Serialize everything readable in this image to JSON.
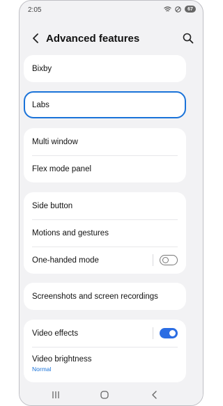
{
  "status_bar": {
    "time": "2:05",
    "battery": "67"
  },
  "header": {
    "title": "Advanced features",
    "back_icon": "chevron-left-icon",
    "search_icon": "search-icon"
  },
  "cards": {
    "bixby": {
      "label": "Bixby"
    },
    "labs": {
      "label": "Labs"
    },
    "multi": {
      "multi_window": "Multi window",
      "flex_mode_panel": "Flex mode panel"
    },
    "side": {
      "side_button": "Side button",
      "motions_gestures": "Motions and gestures",
      "one_handed_mode": "One-handed mode",
      "one_handed_enabled": false
    },
    "screenshots": {
      "label": "Screenshots and screen recordings"
    },
    "video": {
      "video_effects": "Video effects",
      "video_effects_enabled": true,
      "video_brightness": "Video brightness",
      "video_brightness_value": "Normal"
    }
  },
  "colors": {
    "accent": "#1a73d9",
    "toggle_on": "#2b6de3",
    "background": "#f2f2f4"
  },
  "navbar": {
    "recents_icon": "recents-icon",
    "home_icon": "home-icon",
    "back_icon": "back-icon"
  }
}
